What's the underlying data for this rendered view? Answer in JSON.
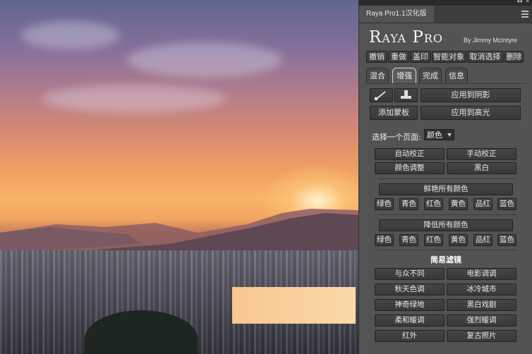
{
  "panel": {
    "window_title": "Raya Pro1.1汉化版",
    "brand": "Raya Pro",
    "byline": "By Jimmy McIntyre",
    "toolbar": [
      "撤销",
      "重做",
      "盖印",
      "智能对象",
      "取消选择",
      "删除"
    ],
    "tabs": [
      "混合",
      "增强",
      "完成",
      "信息"
    ],
    "active_tab": "增强",
    "apply_shadows": "应用到阴影",
    "add_mask": "添加蒙板",
    "apply_highlights": "应用到高光",
    "page_select_label": "选择一个页面:",
    "page_select_value": "颜色",
    "auto_correct": "自动校正",
    "manual_correct": "手动校正",
    "color_adjust": "颜色调整",
    "black_white": "黑白",
    "vivid_all": "鲜艳所有颜色",
    "reduce_all": "降低所有颜色",
    "color_buttons": [
      "绿色",
      "青色",
      "红色",
      "黄色",
      "品红",
      "蓝色"
    ],
    "filters_title": "简易滤镜",
    "filters": [
      [
        "与众不同",
        "电影调调"
      ],
      [
        "秋天色调",
        "冰冷城市"
      ],
      [
        "神奇绿地",
        "黑白戏剧"
      ],
      [
        "柔和暖调",
        "强烈暖调"
      ],
      [
        "红外",
        "复古照片"
      ]
    ]
  },
  "colors": {
    "panel_bg": "#535353",
    "button_bg": "#3f3f3f",
    "text": "#e8e8e8"
  }
}
